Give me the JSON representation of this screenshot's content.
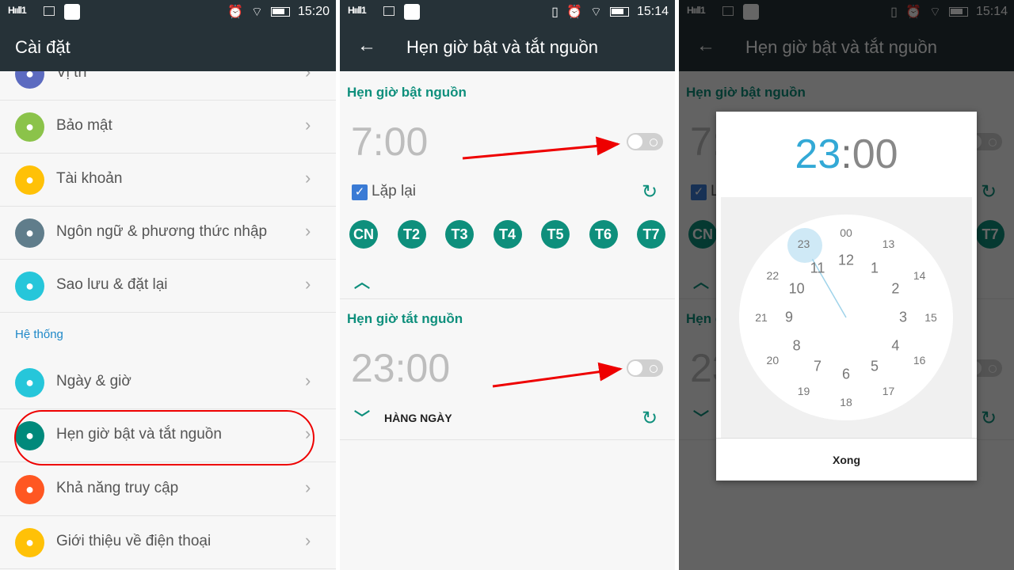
{
  "panel1": {
    "status": {
      "signal": "Hııll1",
      "time": "15:20"
    },
    "title": "Cài đặt",
    "items": [
      {
        "label": "Vị trí",
        "color": "#5c6bc0",
        "icon": "location-icon"
      },
      {
        "label": "Bảo mật",
        "color": "#8bc34a",
        "icon": "security-icon"
      },
      {
        "label": "Tài khoản",
        "color": "#ffc107",
        "icon": "account-icon"
      },
      {
        "label": "Ngôn ngữ & phương thức nhập",
        "color": "#607d8b",
        "icon": "language-icon"
      },
      {
        "label": "Sao lưu & đặt lại",
        "color": "#26c6da",
        "icon": "backup-icon"
      }
    ],
    "section": "Hệ thống",
    "system_items": [
      {
        "label": "Ngày & giờ",
        "color": "#26c6da",
        "icon": "clock-icon"
      },
      {
        "label": "Hẹn giờ bật và tắt nguồn",
        "color": "#00897b",
        "icon": "power-schedule-icon"
      },
      {
        "label": "Khả năng truy cập",
        "color": "#ff5722",
        "icon": "accessibility-icon"
      },
      {
        "label": "Giới thiệu về điện thoại",
        "color": "#ffc107",
        "icon": "info-icon"
      }
    ]
  },
  "panel2": {
    "status": {
      "signal": "Hııll1",
      "time": "15:14"
    },
    "title": "Hẹn giờ bật và tắt nguồn",
    "on": {
      "heading": "Hẹn giờ bật nguồn",
      "time": "7:00",
      "enabled": false,
      "repeat_label": "Lặp lại",
      "repeat_checked": true,
      "days": [
        "CN",
        "T2",
        "T3",
        "T4",
        "T5",
        "T6",
        "T7"
      ]
    },
    "off": {
      "heading": "Hẹn giờ tắt nguồn",
      "time": "23:00",
      "enabled": false,
      "repeat_text": "HÀNG NGÀY"
    }
  },
  "dialog": {
    "hour": "23",
    "sep": ":",
    "minute": "00",
    "selected_hour": 23,
    "done_label": "Xong",
    "outer_numbers": [
      "00",
      "13",
      "14",
      "15",
      "16",
      "17",
      "18",
      "19",
      "20",
      "21",
      "22",
      "23"
    ],
    "inner_numbers": [
      "12",
      "1",
      "2",
      "3",
      "4",
      "5",
      "6",
      "7",
      "8",
      "9",
      "10",
      "11"
    ]
  },
  "colors": {
    "accent": "#0e8f7c",
    "appbar": "#263238",
    "annotation": "#e00000",
    "dial_accent": "#33a9d6"
  }
}
